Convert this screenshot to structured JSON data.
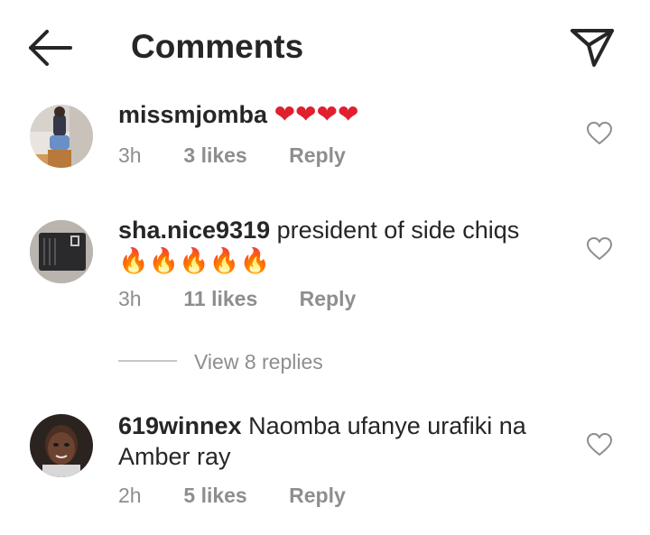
{
  "header": {
    "title": "Comments",
    "back_icon": "arrow-left-icon",
    "send_icon": "paper-plane-icon"
  },
  "comments": [
    {
      "username": "missmjomba",
      "text": "",
      "emoji": "❤❤❤❤",
      "time": "3h",
      "likes": "3 likes",
      "reply": "Reply"
    },
    {
      "username": "sha.nice9319",
      "text": "president of side chiqs",
      "emoji": "🔥🔥🔥🔥🔥",
      "time": "3h",
      "likes": "11 likes",
      "reply": "Reply"
    },
    {
      "username": "619winnex",
      "text": "Naomba ufanye urafiki na Amber ray",
      "emoji": "",
      "time": "2h",
      "likes": "5 likes",
      "reply": "Reply"
    }
  ],
  "view_replies": "View 8 replies",
  "colors": {
    "text": "#262626",
    "secondary": "#8e8e8e",
    "heart_red": "#e0202f",
    "divider": "#c7c7c7"
  }
}
